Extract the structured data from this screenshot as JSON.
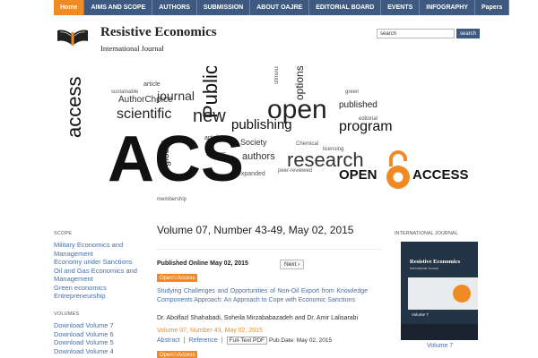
{
  "nav": {
    "items": [
      "Home",
      "AIMS AND SCOPE",
      "AUTHORS",
      "SUBMISSION",
      "ABOUT OAJRE",
      "EDITORIAL BOARD",
      "EVENTS",
      "INFOGRAPHY",
      "Papers"
    ],
    "active": "Home"
  },
  "header": {
    "title": "Resistive Economics",
    "subtitle": "International Journal",
    "search_value": "search",
    "search_button": "search"
  },
  "banner": {
    "big_word": "ACS",
    "open_access_label_left": "OPEN",
    "open_access_label_right": "ACCESS",
    "words": [
      "access",
      "scientific",
      "journal",
      "Publications",
      "article",
      "AuthorChoice",
      "publishing",
      "open",
      "research",
      "program",
      "published",
      "authors",
      "options",
      "expanded",
      "Society",
      "global",
      "Editors",
      "articles",
      "peer-reviewed",
      "Chemical",
      "licensing",
      "editorial",
      "membership",
      "stimulus",
      "green",
      "new",
      "sustainable"
    ]
  },
  "left_sidebar": {
    "scope_heading": "SCOPE",
    "scope_links": [
      "Military Economics and",
      "Management",
      "Economy under Sanctions",
      "Oil and Gas Economics and",
      "Management",
      "Green economics",
      "Entrepreneurship"
    ],
    "volumes_heading": "VOLUMES",
    "volume_links": [
      "Download Volume 7",
      "Download Volume 6",
      "Download Volume 5",
      "Download Volume 4"
    ]
  },
  "main": {
    "volume_title": "Volume 07, Number 43-49, May 02, 2015",
    "published_online": "Published Online May 02, 2015",
    "next_button": "Next ›",
    "open_access_badge": "Open☉Access",
    "article": {
      "title": "Studying Challenges and Opportunities of Non-Oil Export from Knowledge Components Approach: An Approach to Cope with Economic Sanctions",
      "authors": "Dr. Abolfazl Shahabadi, Soheila Mirzababazadeh and Dr. Amir Lalisarabi",
      "issue": "Volume 07, Number 43, May 02, 2015",
      "abstract_link": "Abstract",
      "reference_link": "Reference",
      "fulltext_link": "Full-Text PDF",
      "pub_date": "Pub.Date: May 02, 2015"
    }
  },
  "right_sidebar": {
    "heading": "INTERNATIONAL JOURNAL",
    "cover_title": "Resistive Economics",
    "cover_subtitle": "International Journal",
    "cover_volume": "Volume 7",
    "caption": "Volume 7"
  },
  "colors": {
    "nav_bg": "#3f5a80",
    "accent_orange": "#f08a24",
    "link_blue": "#4a6fa5"
  }
}
